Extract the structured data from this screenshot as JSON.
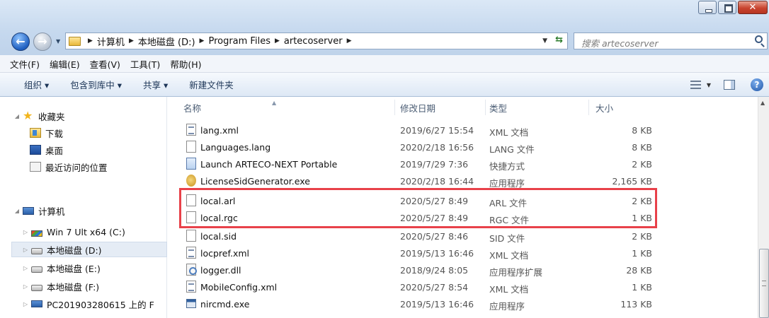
{
  "address": {
    "crumbs": [
      "计算机",
      "本地磁盘 (D:)",
      "Program Files",
      "artecoserver"
    ],
    "search_placeholder": "搜索 artecoserver"
  },
  "menu": [
    "文件(F)",
    "编辑(E)",
    "查看(V)",
    "工具(T)",
    "帮助(H)"
  ],
  "toolbar": {
    "organize": "组织 ▾",
    "include_in_library": "包含到库中 ▾",
    "share": "共享 ▾",
    "new_folder": "新建文件夹"
  },
  "nav": {
    "favorites": "收藏夹",
    "downloads": "下载",
    "desktop": "桌面",
    "recent": "最近访问的位置",
    "computer": "计算机",
    "drive_c": "Win 7 Ult x64 (C:)",
    "drive_d": "本地磁盘 (D:)",
    "drive_e": "本地磁盘 (E:)",
    "drive_f": "本地磁盘 (F:)",
    "network_pc": "PC201903280615 上的 F"
  },
  "columns": {
    "name": "名称",
    "date": "修改日期",
    "type": "类型",
    "size": "大小"
  },
  "files": [
    {
      "name": "lang.xml",
      "date": "2019/6/27 15:54",
      "type": "XML 文档",
      "size": "8 KB"
    },
    {
      "name": "Languages.lang",
      "date": "2020/2/18 16:56",
      "type": "LANG 文件",
      "size": "8 KB"
    },
    {
      "name": "Launch ARTECO-NEXT Portable",
      "date": "2019/7/29 7:36",
      "type": "快捷方式",
      "size": "2 KB"
    },
    {
      "name": "LicenseSidGenerator.exe",
      "date": "2020/2/18 16:44",
      "type": "应用程序",
      "size": "2,165 KB"
    },
    {
      "name": "local.arl",
      "date": "2020/5/27 8:49",
      "type": "ARL 文件",
      "size": "2 KB"
    },
    {
      "name": "local.rgc",
      "date": "2020/5/27 8:49",
      "type": "RGC 文件",
      "size": "1 KB"
    },
    {
      "name": "local.sid",
      "date": "2020/5/27 8:46",
      "type": "SID 文件",
      "size": "2 KB"
    },
    {
      "name": "locpref.xml",
      "date": "2019/5/13 16:46",
      "type": "XML 文档",
      "size": "1 KB"
    },
    {
      "name": "logger.dll",
      "date": "2018/9/24 8:05",
      "type": "应用程序扩展",
      "size": "28 KB"
    },
    {
      "name": "MobileConfig.xml",
      "date": "2020/5/27 8:54",
      "type": "XML 文档",
      "size": "1 KB"
    },
    {
      "name": "nircmd.exe",
      "date": "2019/5/13 16:46",
      "type": "应用程序",
      "size": "113 KB"
    }
  ]
}
